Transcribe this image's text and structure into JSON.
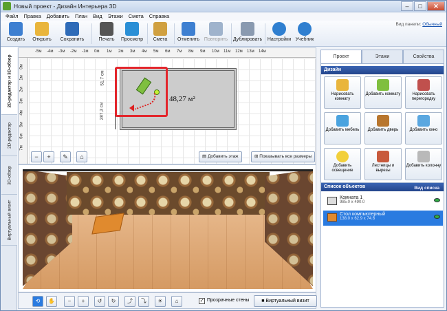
{
  "window": {
    "title": "Новый проект - Дизайн Интерьера 3D",
    "minimize": "–",
    "maximize": "□",
    "close": "✕"
  },
  "menu": [
    "Файл",
    "Правка",
    "Добавить",
    "План",
    "Вид",
    "Этажи",
    "Смета",
    "Справка"
  ],
  "toolbar": {
    "panel_view_label": "Вид панели:",
    "panel_view_value": "Обычный",
    "buttons": [
      {
        "label": "Создать",
        "icon": "new-document-icon",
        "color": "#3d7fd1"
      },
      {
        "label": "Открыть",
        "icon": "open-folder-icon",
        "color": "#e9b53c"
      },
      {
        "label": "Сохранить",
        "icon": "save-floppy-icon",
        "color": "#2e6bb8"
      },
      {
        "label": "Печать",
        "icon": "printer-icon",
        "color": "#555555"
      },
      {
        "label": "Просмотр",
        "icon": "monitor-icon",
        "color": "#2a8fd6"
      },
      {
        "label": "Смета",
        "icon": "estimate-icon",
        "color": "#d0a040"
      },
      {
        "label": "Отменить",
        "icon": "undo-icon",
        "color": "#3d7fd1"
      },
      {
        "label": "Повторить",
        "icon": "redo-icon",
        "color": "#9fb3cc"
      },
      {
        "label": "Дублировать",
        "icon": "duplicate-icon",
        "color": "#8a9ab0"
      },
      {
        "label": "Настройки",
        "icon": "gear-icon",
        "color": "#2f7fd0"
      },
      {
        "label": "Учебник",
        "icon": "help-icon",
        "color": "#2f7fd0"
      }
    ]
  },
  "left_tabs": [
    "2D-редактор и 3D-обзор",
    "2D-редактор",
    "3D-обзор",
    "Виртуальный визит"
  ],
  "plan2d": {
    "ruler_top": [
      "-5м",
      "-4м",
      "-3м",
      "-2м",
      "-1м",
      "0м",
      "1м",
      "2м",
      "3м",
      "4м",
      "5м",
      "6м",
      "7м",
      "8м",
      "9м",
      "10м",
      "11м",
      "12м",
      "13м",
      "14м"
    ],
    "ruler_left": [
      "0м",
      "1м",
      "2м",
      "3м",
      "4м",
      "5м",
      "6м",
      "7м"
    ],
    "room_area": "48,27 м²",
    "dim_top": "51,7 см",
    "dim_left": "287,3 см",
    "add_floor": "Добавить этаж",
    "show_all_sizes": "Показывать все размеры"
  },
  "view3d": {
    "transparent_walls_label": "Прозрачные стены",
    "transparent_walls_checked": true,
    "virtual_visit": "Виртуальный визит"
  },
  "right_panel": {
    "tabs": [
      "Проект",
      "Этажи",
      "Свойства"
    ],
    "active_tab": "Проект",
    "design_header": "Дизайн",
    "design_buttons": [
      {
        "label": "Нарисовать комнату",
        "icon": "draw-room-icon",
        "color": "#e9b53c"
      },
      {
        "label": "Добавить комнату",
        "icon": "add-room-icon",
        "color": "#7fbf3f"
      },
      {
        "label": "Нарисовать перегородку",
        "icon": "draw-partition-icon",
        "color": "#c0504d"
      },
      {
        "label": "Добавить мебель",
        "icon": "add-furniture-icon",
        "color": "#4aa3df"
      },
      {
        "label": "Добавить дверь",
        "icon": "add-door-icon",
        "color": "#b8762e"
      },
      {
        "label": "Добавить окно",
        "icon": "add-window-icon",
        "color": "#5aa7e0"
      },
      {
        "label": "Добавить освещение",
        "icon": "add-lighting-icon",
        "color": "#f2d03b"
      },
      {
        "label": "Лестницы и вырезы",
        "icon": "stairs-icon",
        "color": "#c85a3c"
      },
      {
        "label": "Добавить колонну",
        "icon": "add-column-icon",
        "color": "#b9b9b9"
      }
    ],
    "objects_header": "Список объектов",
    "objects_view": "Вид списка",
    "objects": [
      {
        "name": "Комната 1",
        "size": "985.0 x 490.0",
        "selected": false
      },
      {
        "name": "Стол компьютерный",
        "size": "138.0 x 62.9 x 74.6",
        "selected": true
      }
    ]
  }
}
